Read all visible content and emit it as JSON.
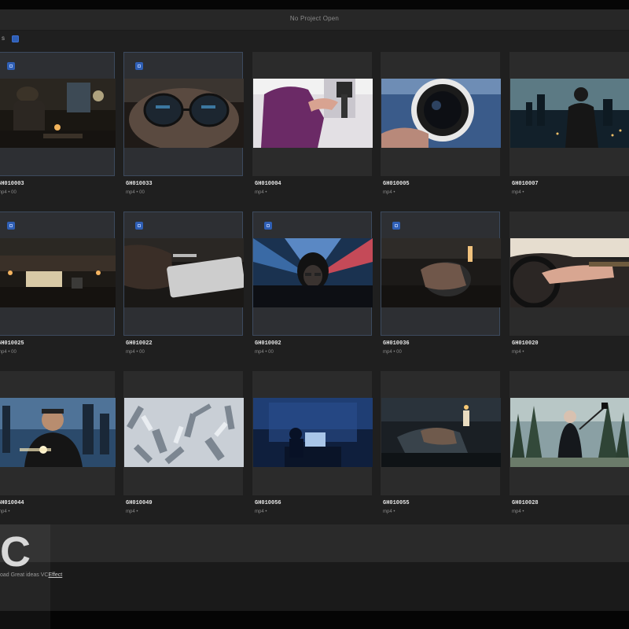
{
  "window": {
    "title": "No Project Open"
  },
  "toolbar": {
    "label": "s",
    "select_all_checked": true
  },
  "clips": [
    {
      "name": "GH010003",
      "meta": "mp4 • 00",
      "selected": true,
      "checked": true,
      "scene": "night-desk"
    },
    {
      "name": "GH010033",
      "meta": "mp4 • 00",
      "selected": true,
      "checked": true,
      "scene": "glasses-closeup"
    },
    {
      "name": "GH010004",
      "meta": "mp4 •",
      "selected": false,
      "checked": false,
      "scene": "pink-hoodie"
    },
    {
      "name": "GH010005",
      "meta": "mp4 •",
      "selected": false,
      "checked": false,
      "scene": "camera-lens"
    },
    {
      "name": "GH010007",
      "meta": "mp4 •",
      "selected": false,
      "checked": false,
      "scene": "city-rooftop"
    },
    {
      "name": "GH010025",
      "meta": "mp4 • 00",
      "selected": true,
      "checked": true,
      "scene": "desk-lights"
    },
    {
      "name": "GH010022",
      "meta": "mp4 • 00",
      "selected": true,
      "checked": true,
      "scene": "hand-keyboard"
    },
    {
      "name": "GH010002",
      "meta": "mp4 • 00",
      "selected": true,
      "checked": true,
      "scene": "hooded-figure"
    },
    {
      "name": "GH010036",
      "meta": "mp4 • 00",
      "selected": true,
      "checked": true,
      "scene": "mouse-hand"
    },
    {
      "name": "GH010020",
      "meta": "mp4 •",
      "selected": false,
      "checked": false,
      "scene": "car-steering"
    },
    {
      "name": "GH010044",
      "meta": "mp4 •",
      "selected": false,
      "checked": false,
      "scene": "smiling-man"
    },
    {
      "name": "GH010049",
      "meta": "mp4 •",
      "selected": false,
      "checked": false,
      "scene": "aerial-city"
    },
    {
      "name": "GH010056",
      "meta": "mp4 •",
      "selected": false,
      "checked": false,
      "scene": "blue-room"
    },
    {
      "name": "GH010055",
      "meta": "mp4 •",
      "selected": false,
      "checked": false,
      "scene": "candle-desk"
    },
    {
      "name": "GH010028",
      "meta": "mp4 •",
      "selected": false,
      "checked": false,
      "scene": "forest-selfie"
    }
  ],
  "watermark": {
    "letter": "C",
    "caption_prefix": "oad Great ideas VC",
    "caption_link": "Effect"
  },
  "colors": {
    "accent": "#2f5fb5",
    "background": "#1f1f1f",
    "tile": "#2b2b2b"
  }
}
